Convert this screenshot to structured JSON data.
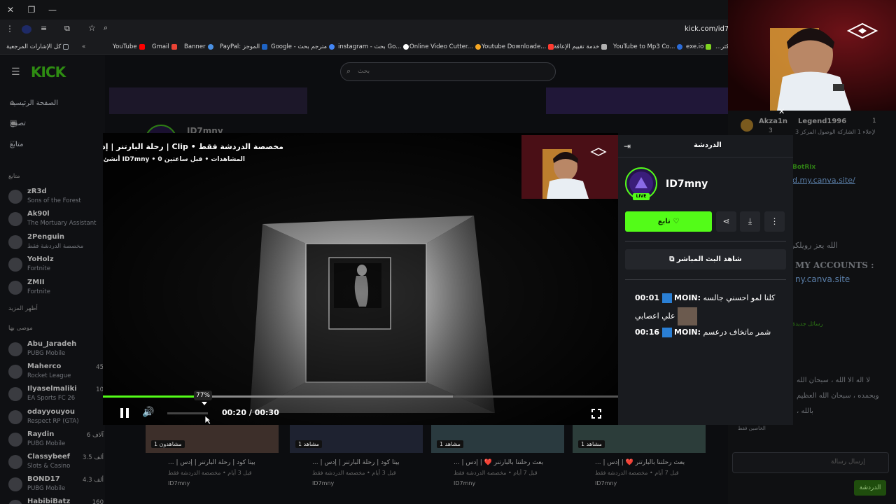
{
  "browser": {
    "url": "kick.com/id7m",
    "bookmarks": [
      {
        "label": "كل الإشارات المرجعية",
        "color": "#9aa0a6"
      },
      {
        "label": "YouTube",
        "color": "#ff0000"
      },
      {
        "label": "Gmail",
        "color": "#ea4335"
      },
      {
        "label": "Banner",
        "color": "#4a90e2"
      },
      {
        "label": "PayPal: الموجز",
        "color": "#1e63c4"
      },
      {
        "label": "Google - مترجم بحث",
        "color": "#4285f4"
      },
      {
        "label": "instagram - بحث Go...",
        "color": "#e4405f"
      },
      {
        "label": "Online Video Cutter...",
        "color": "#f5a623"
      },
      {
        "label": "Youtube Downloade...",
        "color": "#ff3b30"
      },
      {
        "label": "خدمة تقييم الإعاقة",
        "color": "#b0b0b0"
      },
      {
        "label": "YouTube to Mp3 Co...",
        "color": "#2b6cd9"
      },
      {
        "label": "exe.io",
        "color": "#7ed321"
      },
      {
        "label": "...كثر",
        "color": "#777"
      }
    ]
  },
  "kick": {
    "logo": "KICK",
    "search_placeholder": "بحث",
    "nav": [
      {
        "label": "الصفحة الرئيسية",
        "icon": "home-icon"
      },
      {
        "label": "تصفح",
        "icon": "browse-icon"
      },
      {
        "label": "متابع",
        "icon": "heart-icon"
      }
    ],
    "following_header": "متابع",
    "following": [
      {
        "name": "zR3d",
        "game": "Sons of the Forest",
        "viewers": ""
      },
      {
        "name": "Ak90l",
        "game": "The Mortuary Assistant",
        "viewers": ""
      },
      {
        "name": "2Penguin",
        "game": "مخصصة الدردشة فقط",
        "viewers": ""
      },
      {
        "name": "YoHolz",
        "game": "Fortnite",
        "viewers": ""
      },
      {
        "name": "ZMII",
        "game": "Fortnite",
        "viewers": ""
      }
    ],
    "show_more": "أظهر المزيد",
    "recommended_header": "موصى بها",
    "recommended": [
      {
        "name": "Abu_Jaradeh",
        "game": "PUBG Mobile",
        "viewers": ""
      },
      {
        "name": "Maherco",
        "game": "Rocket League",
        "viewers": "45"
      },
      {
        "name": "Ilyaselmaliki",
        "game": "EA Sports FC 26",
        "viewers": "10"
      },
      {
        "name": "odayyouyou",
        "game": "Respect RP (GTA)",
        "viewers": ""
      },
      {
        "name": "Raydin",
        "game": "PUBG Mobile",
        "viewers": "6 آلاف"
      },
      {
        "name": "Classybeef",
        "game": "Slots & Casino",
        "viewers": "3.5 ألف"
      },
      {
        "name": "BOND17",
        "game": "PUBG Mobile",
        "viewers": "4.3 ألف"
      },
      {
        "name": "HabibiBatz",
        "game": "",
        "viewers": "160"
      }
    ]
  },
  "clip": {
    "title": "مخصصة الدردشة فقط • Clip | رحلة البارتنر | إدس | LOL!",
    "meta": "المشاهدات • قبل ساعتين 0 • ID7mny أنشئ من قبل",
    "progress_label": "77%",
    "progress_played": 0.18,
    "progress_buffered": 0.68,
    "time_current": "00:20",
    "time_total": "00:30"
  },
  "panel": {
    "header": "الدردشة",
    "channel_name": "ID7mny",
    "live_badge": "LIVE",
    "follow_label": "تابع",
    "watch_live_label": "شاهد البث المباشر",
    "messages": [
      {
        "time": "00:01",
        "user": "MOIN:",
        "text": "كلنا لمو احسني جالسه",
        "text2": "علي اعصابي"
      },
      {
        "time": "00:16",
        "user": "MOIN:",
        "text": "شمر ماتخاف درعسم",
        "text2": ""
      }
    ]
  },
  "cards": [
    {
      "views": "1 مشاهد",
      "title": "بيتا كود | رحلة البارتنر | إدس | ...",
      "meta": "قبل 3 أيام • مخصصة الدردشة فقط",
      "user": "ID7mny"
    },
    {
      "views": "1 مشاهد",
      "title": "بيتا كود | رحلة البارتنر | إدس | ...",
      "meta": "قبل 3 أيام • مخصصة الدردشة فقط",
      "user": "ID7mny"
    },
    {
      "views": "1 مشاهد",
      "title": "بعث رحلتنا بالبارتنر ❤️ | إدس | ...",
      "meta": "قبل 7 أيام • مخصصة الدردشة فقط",
      "user": "ID7mny"
    }
  ],
  "bg_profile": {
    "name": "ID7mny",
    "card0_views": "مشاهدون 1"
  },
  "right_chat": {
    "users": [
      {
        "name": "Akza1n",
        "count": "3"
      },
      {
        "name": "Legend1996",
        "count": "1"
      }
    ],
    "pinned": "لإعلاء 1 الشاركة الوصول المركز 3",
    "bot": "BotRix",
    "link": "d.my.canva.site/",
    "accounts": "MY ACCOUNTS :",
    "site": "ny.canva.site",
    "line1": "الله يعز رويلكر",
    "new_msgs": "رسائل جديدة",
    "line2": "لا اله الا الله ، سبحان الله",
    "line3": "وبحمده ، سبحان الله العظيم",
    "line4": "بالله ،",
    "input_placeholder": "إرسال رسالة",
    "send": "الدردشة",
    "welcome": "الخاصين فقط"
  }
}
